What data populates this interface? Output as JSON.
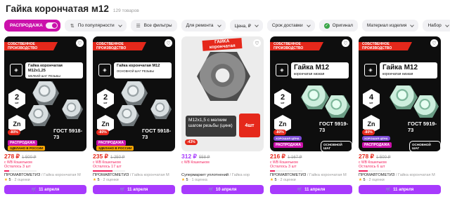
{
  "header": {
    "title": "Гайка корончатая м12",
    "count": "129 товаров"
  },
  "filters": {
    "sale": "РАСПРОДАЖА",
    "sort": "По популярности",
    "all": "Все фильтры",
    "for_repair": "Для ремонта",
    "price": "Цена, ₽",
    "delivery": "Срок доставки",
    "original": "Оригинал",
    "material": "Материал изделия",
    "set": "Набор"
  },
  "icons": {
    "sort": "sort-icon",
    "filters": "sliders-icon",
    "check": "check-icon",
    "heart": "heart-icon",
    "cart": "cart-icon",
    "star": "star-icon"
  },
  "colors": {
    "sale": "#cb11ab",
    "buy": "#a73afd",
    "price": "#e5281b"
  },
  "products": [
    {
      "ribbon": "СОБСТВЕННОЕ ПРОИЗВОДСТВО",
      "img_title": "Гайка корончатая М12х1,25",
      "img_sub": "МЕЛКИЙ ШАГ РЕЗЬБЫ",
      "qty": "2",
      "qty_unit": "шт",
      "zn": "Zn",
      "gost": "ГОСТ 5918-73",
      "badge_disc": "-80%",
      "badge_sale": "РАСПРОДАЖА",
      "badge_made": "ЗДЕЛАНО В РОССИИ",
      "price": "278 ₽",
      "old": "1 500 ₽",
      "wallet": "с WB Кошельком",
      "stock": "Осталось 3 шт",
      "stock_level": 0.15,
      "seller": "ПРОМАВТОМЕТИЗ",
      "name": "Гайка корончатая М",
      "rating": "5",
      "reviews": "2 оценки",
      "delivery": "11 апреля"
    },
    {
      "ribbon": "СОБСТВЕННОЕ ПРОИЗВОДСТВО",
      "img_title": "Гайка корончатая М12",
      "img_sub": "ОСНОВНОЙ ШАГ РЕЗЬБЫ",
      "qty": "2",
      "qty_unit": "шт",
      "zn": "Zn",
      "gost": "ГОСТ 5918-73",
      "badge_disc": "-80%",
      "badge_sale": "РАСПРОДАЖА",
      "badge_made": "ЗДЕЛАНО В РОССИИ",
      "price": "235 ₽",
      "old": "1 250 ₽",
      "wallet": "с WB Кошельком",
      "stock": "Осталось 17 шт",
      "stock_level": 0.6,
      "seller": "ПРОМАВТОМЕТИЗ",
      "name": "Гайка корончатая М",
      "rating": "5",
      "reviews": "2 оценки",
      "delivery": "11 апреля"
    },
    {
      "band": "ГАЙКА корончатая",
      "desc": "М12х1,5 с мелким шагом резьбы (цинк)",
      "pack": "4шт",
      "badge_disc": "-43%",
      "price": "312 ₽",
      "old": "558 ₽",
      "wallet": "с WB Кошельком",
      "seller": "Супермаркет уплотнений",
      "name": "Гайка кор",
      "rating": "5",
      "reviews": "1 оценка",
      "delivery": "10 апреля"
    },
    {
      "ribbon": "СОБСТВЕННОЕ ПРОИЗВОДСТВО",
      "img_title": "Гайка М12",
      "img_sub": "корончатая низкая",
      "qty": "2",
      "qty_unit": "шт",
      "zn": "Zn",
      "gost": "ГОСТ 5919-73",
      "badge_disc": "-80%",
      "badge_good": "ХОРОШАЯ ЦЕНА",
      "badge_sale": "РАСПРОДАЖА",
      "badge_basic": "ОСНОВНОЙ ШАГ",
      "price": "216 ₽",
      "old": "1 167 ₽",
      "wallet": "с WB Кошельком",
      "stock": "Осталось 3 шт",
      "stock_level": 0.15,
      "seller": "ПРОМАВТОМЕТИЗ",
      "name": "Гайка корончатая М",
      "rating": "5",
      "reviews": "2 оценки",
      "delivery": "11 апреля"
    },
    {
      "ribbon": "СОБСТВЕННОЕ ПРОИЗВОДСТВО",
      "img_title": "Гайка М12",
      "img_sub": "корончатая низкая",
      "qty": "4",
      "qty_unit": "шт",
      "zn": "Zn",
      "gost": "ГОСТ 5919-73",
      "badge_disc": "-80%",
      "badge_good": "ХОРОШАЯ ЦЕНА",
      "badge_sale": "РАСПРОДАЖА",
      "badge_basic": "ОСНОВНОЙ ШАГ",
      "price": "278 ₽",
      "old": "1 500 ₽",
      "wallet": "с WB Кошельком",
      "stock": "Осталось 6 шт",
      "stock_level": 0.28,
      "seller": "ПРОМАВТОМЕТИЗ",
      "name": "Гайка корончатая М",
      "rating": "5",
      "reviews": "2 оценки",
      "delivery": "11 апреля"
    }
  ]
}
